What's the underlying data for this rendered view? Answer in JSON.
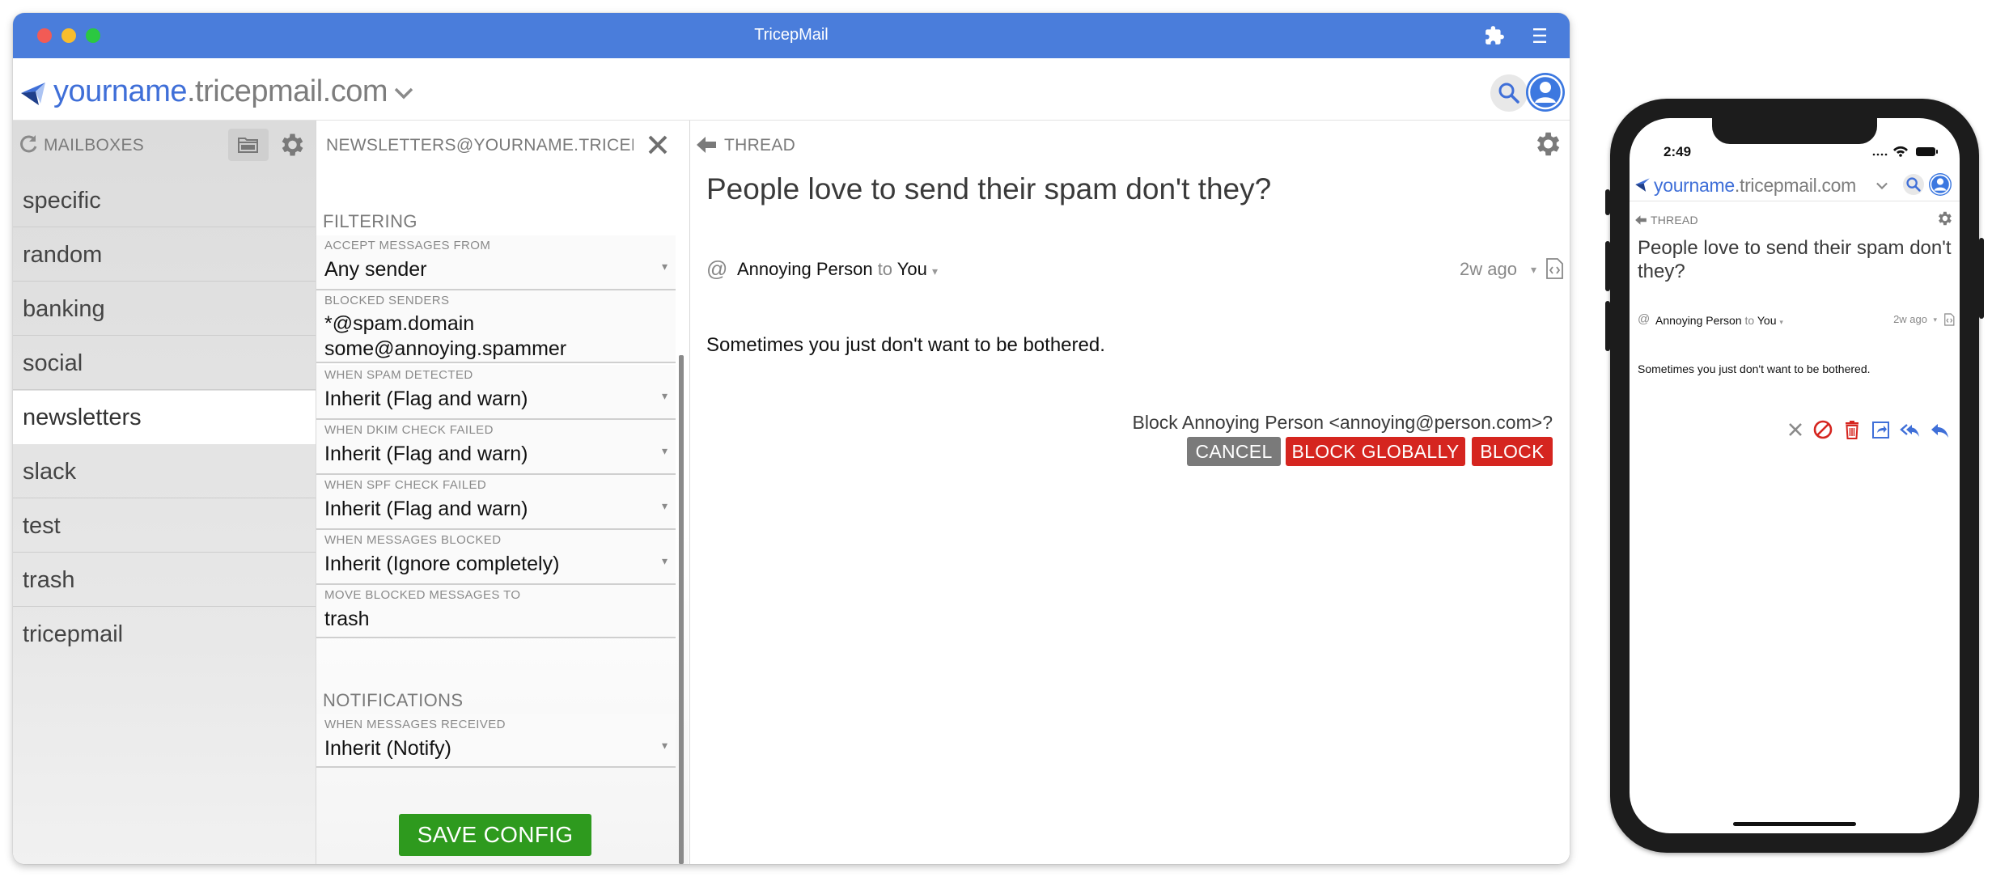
{
  "window": {
    "title": "TricepMail"
  },
  "address": {
    "user": "yourname",
    "domain": ".tricepmail.com"
  },
  "mailboxes": {
    "header": "MAILBOXES",
    "items": [
      {
        "label": "specific"
      },
      {
        "label": "random"
      },
      {
        "label": "banking"
      },
      {
        "label": "social"
      },
      {
        "label": "newsletters",
        "active": true
      },
      {
        "label": "slack"
      },
      {
        "label": "test"
      },
      {
        "label": "trash"
      },
      {
        "label": "tricepmail"
      }
    ]
  },
  "config": {
    "title": "NEWSLETTERS@YOURNAME.TRICEPMAIL.COM",
    "filtering_title": "FILTERING",
    "fields": [
      {
        "label": "ACCEPT MESSAGES FROM",
        "value": "Any sender"
      },
      {
        "label": "BLOCKED SENDERS",
        "value_lines": [
          "*@spam.domain",
          "some@annoying.spammer"
        ]
      },
      {
        "label": "WHEN SPAM DETECTED",
        "value": "Inherit (Flag and warn)"
      },
      {
        "label": "WHEN DKIM CHECK FAILED",
        "value": "Inherit (Flag and warn)"
      },
      {
        "label": "WHEN SPF CHECK FAILED",
        "value": "Inherit (Flag and warn)"
      },
      {
        "label": "WHEN MESSAGES BLOCKED",
        "value": "Inherit (Ignore completely)"
      },
      {
        "label": "MOVE BLOCKED MESSAGES TO",
        "value": "trash"
      }
    ],
    "notifications_title": "NOTIFICATIONS",
    "notify_field": {
      "label": "WHEN MESSAGES RECEIVED",
      "value": "Inherit (Notify)"
    },
    "save_label": "SAVE CONFIG",
    "caret": "▾"
  },
  "thread": {
    "label": "THREAD",
    "subject": "People love to send their spam don't they?",
    "at": "@",
    "from": "Annoying Person",
    "to_word": "to",
    "to": "You",
    "caret": "▾",
    "time": "2w ago",
    "body": "Sometimes you just don't want to be bothered.",
    "block_prompt": "Block Annoying Person <annoying@person.com>?",
    "cancel_label": "CANCEL",
    "block_globally_label": "BLOCK GLOBALLY",
    "block_label": "BLOCK"
  },
  "phone": {
    "time": "2:49",
    "address": {
      "user": "yourname",
      "domain": ".tricepmail.com"
    },
    "thread_label": "THREAD",
    "subject": "People love to send their spam don't they?",
    "at": "@",
    "from": "Annoying Person",
    "to_word": "to",
    "to": "You",
    "caret": "▾",
    "time_ago": "2w ago",
    "body": "Sometimes you just don't want to be bothered.",
    "actions": [
      "close-icon",
      "block-icon",
      "trash-icon",
      "forward-icon",
      "reply-all-icon",
      "reply-icon"
    ]
  },
  "colors": {
    "titlebar": "#4a7ddb",
    "accent_blue": "#3f6fd8",
    "save_green": "#2e9a1e",
    "block_red": "#d5251f",
    "cancel_gray": "#7a7a7a"
  }
}
